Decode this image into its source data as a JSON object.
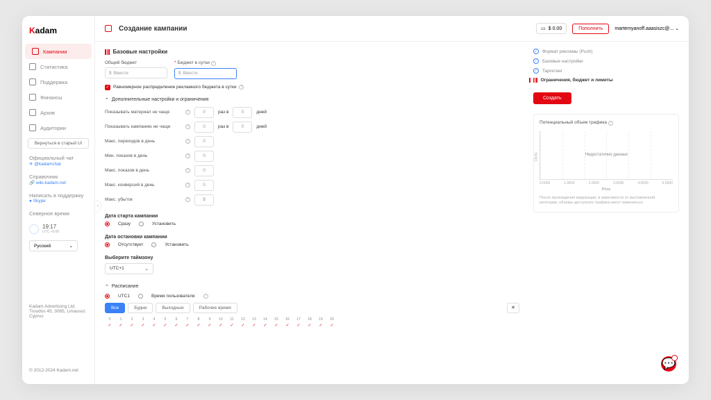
{
  "logo": {
    "p1": "K",
    "p2": "adam"
  },
  "nav": [
    {
      "label": "Кампании",
      "active": true
    },
    {
      "label": "Статистика"
    },
    {
      "label": "Поддержка"
    },
    {
      "label": "Финансы"
    },
    {
      "label": "Архив"
    },
    {
      "label": "Аудитории"
    }
  ],
  "old_ui_btn": "Вернуться в старый UI",
  "chat": {
    "title": "Официальный чат",
    "handle": "@kadamchat"
  },
  "ref": {
    "title": "Справочник",
    "link": "wiki.kadam.net"
  },
  "support": {
    "title": "Написать в поддержку",
    "via": "Skype"
  },
  "servertime": {
    "title": "Северное время",
    "time": "19:17",
    "tz": "UTC +0:00"
  },
  "lang": "Русский",
  "footer1": "Kadam Advertising Ltd. Troodos 45, 3085, Limassol, Cyprus",
  "footer2": "© 2012-2024 Kadam.net",
  "page_title": "Создание кампании",
  "balance": "$ 0.00",
  "topup": "Пополнить",
  "user": "martemyanoff.aaasiszc@...",
  "section_title": "Базовые настройки",
  "budget_total": {
    "label": "Общий бюджет",
    "placeholder": "Ввести",
    "prefix": "$"
  },
  "budget_daily": {
    "label": "Бюджет в сутки",
    "placeholder": "Ввести",
    "prefix": "$"
  },
  "even_dist": "Равномерное распределение рекламного бюджета в сутки",
  "extra_settings": "Дополнительные настройки и ограничения",
  "limits": {
    "show_material": "Показывать материал не чаще",
    "show_campaign": "Показывать кампанию не чаще",
    "max_clicks": "Макс. переходов в день",
    "min_shows": "Мин. показов в день",
    "max_shows": "Макс. показов в день",
    "max_conv": "Макс. конверсий в день",
    "max_loss": "Макс. убыток",
    "times_in": "раз в",
    "days": "дней",
    "zero": "0",
    "dollar": "$"
  },
  "start": {
    "title": "Дата старта кампании",
    "now": "Сразу",
    "set": "Установить"
  },
  "stop": {
    "title": "Дата остановки кампании",
    "none": "Отсутствует",
    "set": "Установить"
  },
  "tz": {
    "title": "Выберите таймзону",
    "value": "UTC+1"
  },
  "schedule": {
    "title": "Расписание",
    "utc": "UTC1",
    "usertime": "Время пользователя",
    "all": "Все",
    "weekdays": "Будни",
    "weekend": "Выходные",
    "work": "Рабочее время",
    "hours": [
      "0",
      "1",
      "2",
      "3",
      "4",
      "5",
      "6",
      "7",
      "8",
      "9",
      "10",
      "11",
      "12",
      "13",
      "14",
      "15",
      "16",
      "17",
      "18",
      "19",
      "20"
    ]
  },
  "steps": [
    {
      "label": "Формат рекламы (Push)"
    },
    {
      "label": "Базовые настройки"
    },
    {
      "label": "Таргетинг"
    },
    {
      "label": "Ограничения, бюджет и лимиты",
      "active": true
    }
  ],
  "create": "Создать",
  "chart": {
    "title": "Потенциальный объем трафика",
    "nodata": "Недостаточно данных",
    "x": [
      "0.0000",
      "1.0000",
      "2.0000",
      "3.0000",
      "4.0000",
      "5.0000"
    ],
    "xlabel": "Price",
    "ylabel": "Clicks",
    "note": "После прохождения модерации, в зависимости от выставленной категории, объемы доступного трафика могут измениться."
  }
}
